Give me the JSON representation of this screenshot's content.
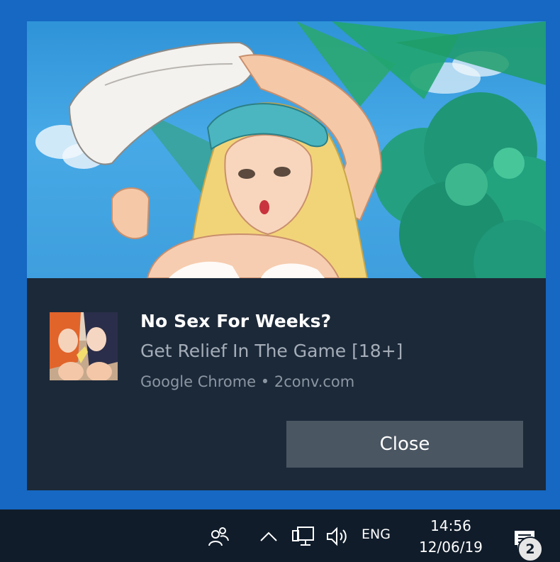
{
  "notification": {
    "title": "No Sex For Weeks?",
    "message": "Get Relief In The Game [18+]",
    "attribution": "Google Chrome • 2conv.com",
    "close_label": "Close",
    "hero_image": "anime-beach-illustration",
    "app_logo": "anime-characters-thumbnail"
  },
  "taskbar": {
    "language": "ENG",
    "time": "14:56",
    "date": "12/06/19",
    "notification_count": "2",
    "icons": [
      "people-icon",
      "chevron-up-icon",
      "network-icon",
      "volume-icon",
      "action-center-icon"
    ]
  },
  "colors": {
    "desktop": "#1668c2",
    "toast_bg": "#1c2939",
    "button_bg": "#4a5662",
    "taskbar_bg": "#101c2a"
  }
}
